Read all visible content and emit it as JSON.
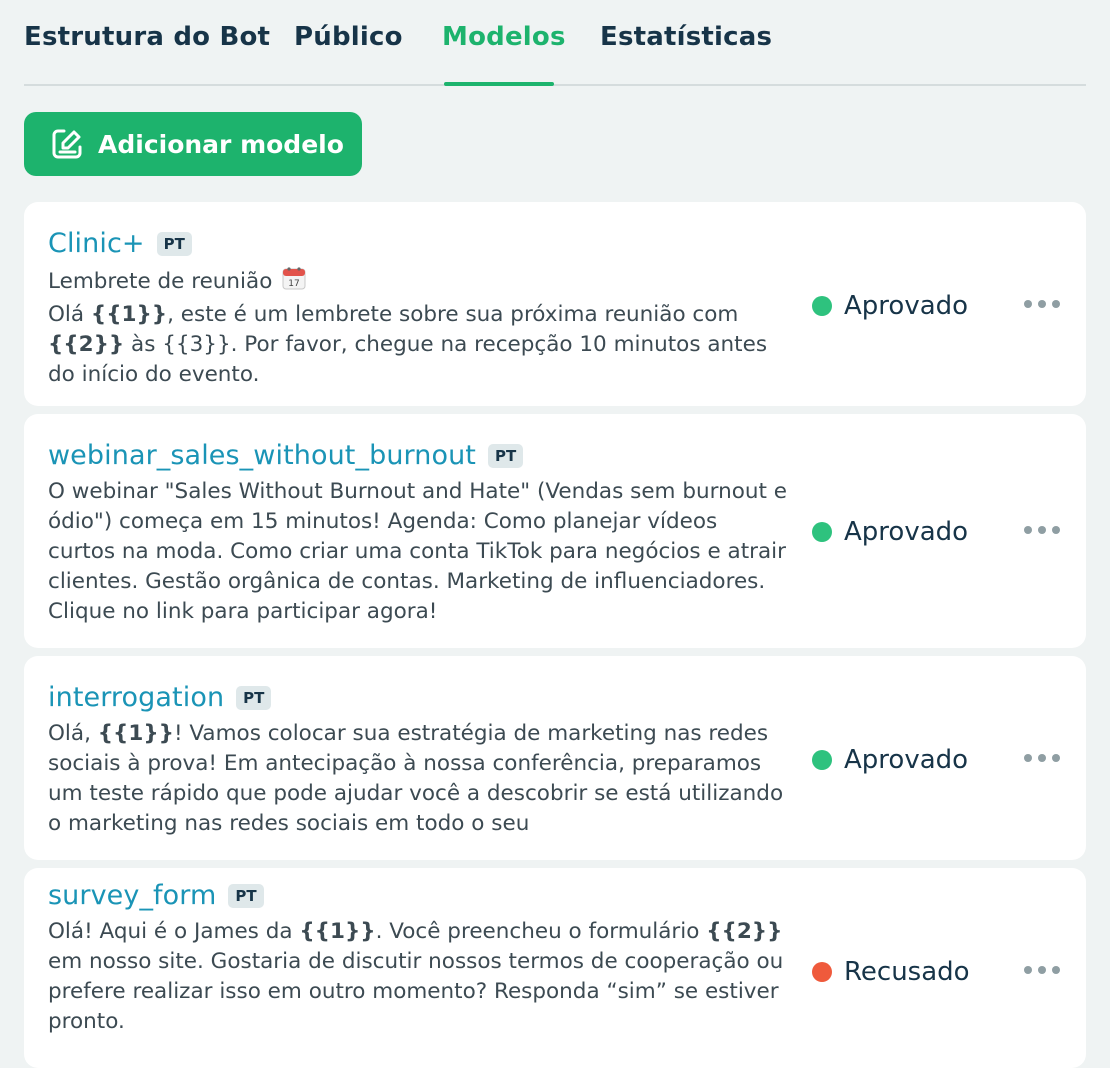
{
  "tabs": [
    {
      "label": "Estrutura do Bot"
    },
    {
      "label": "Público"
    },
    {
      "label": "Modelos",
      "active": true
    },
    {
      "label": "Estatísticas"
    }
  ],
  "add_button": {
    "label": "Adicionar modelo",
    "icon": "edit-template-icon"
  },
  "colors": {
    "accent": "#1db36d",
    "title_link": "#1a94b6",
    "approved": "#2ec27e",
    "rejected": "#ef5a3c"
  },
  "templates": [
    {
      "name": "Clinic+",
      "lang": "PT",
      "subtitle": "Lembrete de reunião",
      "subtitle_icon": "calendar-emoji-icon",
      "body_parts": [
        {
          "text": "Olá "
        },
        {
          "text": "{{1}}",
          "bold": true
        },
        {
          "text": ", este é um lembrete sobre sua próxima reunião com "
        },
        {
          "text": "{{2}}",
          "bold": true
        },
        {
          "text": " às {{3}}. Por favor, chegue na recepção 10 minutos antes do início do evento."
        }
      ],
      "status": "Aprovado",
      "status_color": "#2ec27e"
    },
    {
      "name": "webinar_sales_without_burnout",
      "lang": "PT",
      "body_parts": [
        {
          "text": "O webinar \"Sales Without Burnout and Hate\" (Vendas sem burnout e ódio\") começa em 15 minutos! Agenda: Como planejar vídeos curtos na moda. Como criar uma conta TikTok para negócios e atrair clientes. Gestão orgânica de contas. Marketing de influenciadores. Clique no link para participar agora!"
        }
      ],
      "status": "Aprovado",
      "status_color": "#2ec27e"
    },
    {
      "name": "interrogation",
      "lang": "PT",
      "body_parts": [
        {
          "text": "Olá, "
        },
        {
          "text": "{{1}}",
          "bold": true
        },
        {
          "text": "! Vamos colocar sua estratégia de marketing nas redes sociais à prova! Em antecipação à nossa conferência, preparamos um teste rápido que pode ajudar você a descobrir se está utilizando o marketing nas redes sociais em todo o seu"
        }
      ],
      "status": "Aprovado",
      "status_color": "#2ec27e"
    },
    {
      "name": "survey_form",
      "lang": "PT",
      "body_parts": [
        {
          "text": "Olá! Aqui é o James da "
        },
        {
          "text": "{{1}}",
          "bold": true
        },
        {
          "text": ". Você preencheu o formulário "
        },
        {
          "text": "{{2}}",
          "bold": true
        },
        {
          "text": " em nosso site. Gostaria de discutir nossos termos de cooperação ou prefere realizar isso em outro momento? Responda “sim” se estiver pronto."
        }
      ],
      "status": "Recusado",
      "status_color": "#ef5a3c"
    }
  ]
}
